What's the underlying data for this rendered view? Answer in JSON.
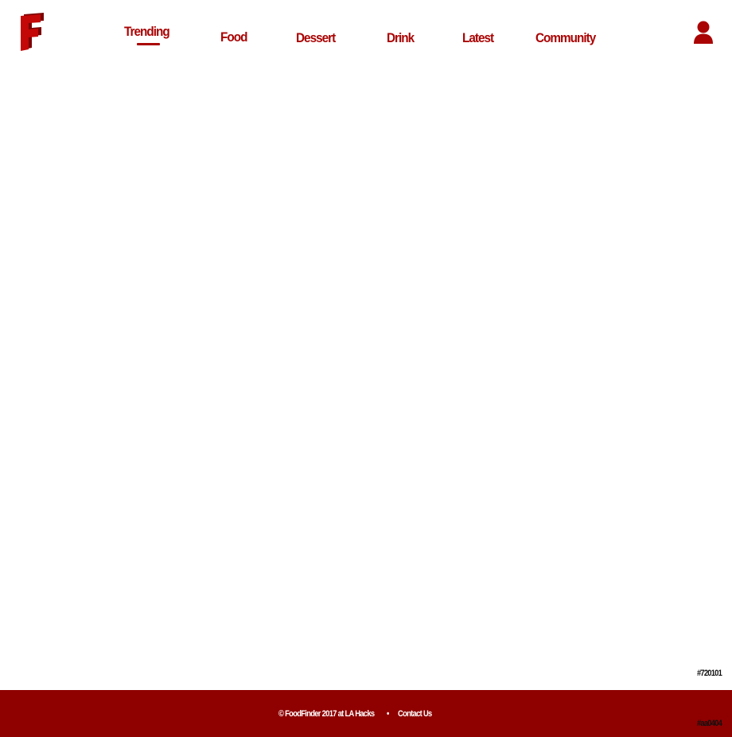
{
  "colors": {
    "brand_red": "#aa0404",
    "dark_red": "#720101",
    "footer_bg": "#8f0000",
    "footer_text": "#ffffff",
    "background": "#ffffff"
  },
  "header": {
    "logo_icon": "foodfinder-f-logo",
    "nav": [
      {
        "label": "Trending",
        "active": true
      },
      {
        "label": "Food",
        "active": false
      },
      {
        "label": "Dessert",
        "active": false
      },
      {
        "label": "Drink",
        "active": false
      },
      {
        "label": "Latest",
        "active": false
      },
      {
        "label": "Community",
        "active": false
      }
    ],
    "user_icon": "user-icon"
  },
  "swatches": {
    "dark_label": "#720101",
    "brand_label": "#aa0404"
  },
  "footer": {
    "copyright": "© FoodFinder 2017 at LA Hacks",
    "separator": "•",
    "contact": "Contact Us"
  }
}
